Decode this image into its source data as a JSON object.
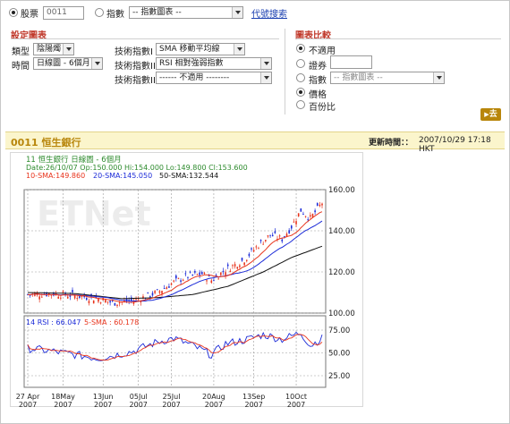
{
  "search": {
    "stock_label": "股票",
    "stock_code": "0011",
    "index_label": "指數",
    "index_select": "-- 指數圖表 --",
    "code_search_link": "代號搜索"
  },
  "settings": {
    "title": "設定圖表",
    "type_label": "類型",
    "type_value": "陰陽燭",
    "time_label": "時間",
    "time_value": "日線圖 - 6個月",
    "ti1_label": "技術指數I",
    "ti1_value": "SMA 移動平均線",
    "ti2_label": "技術指數II",
    "ti2_value": "RSI 相對強弱指數",
    "ti3_label": "技術指數III",
    "ti3_value": "------ 不適用 --------"
  },
  "compare": {
    "title": "圖表比較",
    "opt_na": "不適用",
    "opt_sec": "證券",
    "opt_idx": "指數",
    "idx_select": "-- 指數圖表 --",
    "opt_price": "價格",
    "opt_pct": "百份比",
    "go_label": "去"
  },
  "stock": {
    "name": "0011 恒生銀行",
    "update_label": "更新時間：：",
    "update_time": "2007/10/29 17:18 HKT"
  },
  "chart_data": {
    "type": "line",
    "title": "11 恒生銀行 日線圖 - 6個月",
    "ohlc_text": "Date:26/10/07 Op:150.000 Hi:154.000 Lo:149.800 Cl:153.600",
    "sma_text": {
      "sma10": "10-SMA:149.860",
      "sma20": "20-SMA:145.050",
      "sma50": "50-SMA:132.544"
    },
    "rsi_text": {
      "rsi": "14 RSI : 66.047",
      "sma5": "5-SMA : 60.178"
    },
    "watermark": "ETNet",
    "price_axis": {
      "ylim": [
        100,
        160
      ],
      "ticks": [
        "160.00",
        "140.00",
        "120.00",
        "100.00"
      ]
    },
    "rsi_axis": {
      "ylim": [
        25,
        75
      ],
      "ticks": [
        "75.00",
        "50.00",
        "25.00"
      ]
    },
    "x_ticks": [
      {
        "label": "27 Apr",
        "year": "2007",
        "i": 0
      },
      {
        "label": "18May",
        "year": "2007",
        "i": 15
      },
      {
        "label": "13Jun",
        "year": "2007",
        "i": 32
      },
      {
        "label": "05Jul",
        "year": "2007",
        "i": 47
      },
      {
        "label": "25Jul",
        "year": "2007",
        "i": 61
      },
      {
        "label": "20Aug",
        "year": "2007",
        "i": 79
      },
      {
        "label": "13Sep",
        "year": "2007",
        "i": 96
      },
      {
        "label": "10Oct",
        "year": "2007",
        "i": 114
      }
    ],
    "n_days": 126,
    "close_anchors": [
      [
        0,
        109
      ],
      [
        10,
        109.5
      ],
      [
        20,
        108.5
      ],
      [
        30,
        107
      ],
      [
        36,
        105
      ],
      [
        45,
        106
      ],
      [
        55,
        110
      ],
      [
        62,
        115
      ],
      [
        68,
        118
      ],
      [
        74,
        119
      ],
      [
        78,
        116
      ],
      [
        84,
        121
      ],
      [
        92,
        126
      ],
      [
        97,
        132
      ],
      [
        103,
        138
      ],
      [
        108,
        136
      ],
      [
        112,
        142
      ],
      [
        116,
        150
      ],
      [
        120,
        146
      ],
      [
        125,
        153.6
      ]
    ],
    "sma50_anchors": [
      [
        0,
        110
      ],
      [
        20,
        109.5
      ],
      [
        40,
        107
      ],
      [
        55,
        107.5
      ],
      [
        70,
        109
      ],
      [
        85,
        113
      ],
      [
        100,
        120
      ],
      [
        112,
        127
      ],
      [
        125,
        132.5
      ]
    ],
    "rsi_anchors": [
      [
        0,
        55
      ],
      [
        10,
        52
      ],
      [
        20,
        48
      ],
      [
        30,
        44
      ],
      [
        38,
        48
      ],
      [
        45,
        52
      ],
      [
        55,
        62
      ],
      [
        62,
        66
      ],
      [
        70,
        58
      ],
      [
        78,
        48
      ],
      [
        84,
        60
      ],
      [
        92,
        64
      ],
      [
        100,
        70
      ],
      [
        108,
        65
      ],
      [
        116,
        72
      ],
      [
        120,
        58
      ],
      [
        125,
        66
      ]
    ],
    "colors": {
      "sma10": "#e8341c",
      "sma20": "#1c2bd8",
      "sma50": "#111111",
      "up": "#e8341c",
      "down": "#1c2bd8",
      "title_green": "#2e8b2e",
      "grid": "#9a9a9a"
    }
  }
}
